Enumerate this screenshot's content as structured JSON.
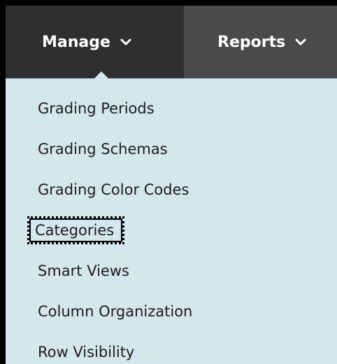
{
  "nav": {
    "tabs": [
      {
        "label": "Manage",
        "icon": "chevron-down-icon",
        "active": true
      },
      {
        "label": "Reports",
        "icon": "chevron-down-icon",
        "active": false
      }
    ]
  },
  "menu": {
    "items": [
      {
        "label": "Grading Periods"
      },
      {
        "label": "Grading Schemas"
      },
      {
        "label": "Grading Color Codes"
      },
      {
        "label": "Categories",
        "focused": true
      },
      {
        "label": "Smart Views"
      },
      {
        "label": "Column Organization"
      },
      {
        "label": "Row Visibility"
      }
    ]
  },
  "colors": {
    "nav_background": "#4a4a4a",
    "active_tab": "#2f2f2f",
    "menu_background": "#d3e7ec",
    "text": "#1d1d1d"
  }
}
